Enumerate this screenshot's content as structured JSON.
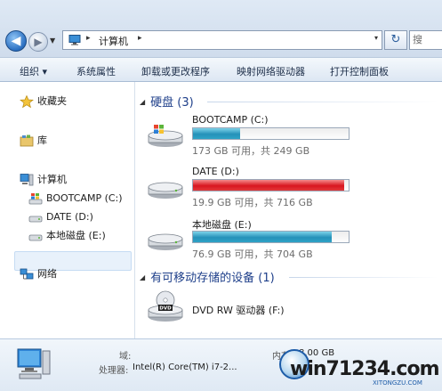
{
  "address": {
    "crumb": "计算机",
    "sep1": "▸",
    "sep2": "▸",
    "dropdown": "▾",
    "search_text": "搜"
  },
  "toolbar": {
    "organize": "组织 ▾",
    "system_properties": "系统属性",
    "uninstall": "卸载或更改程序",
    "map_drive": "映射网络驱动器",
    "control_panel": "打开控制面板"
  },
  "nav": {
    "favorites": "收藏夹",
    "libraries": "库",
    "computer": "计算机",
    "drives": [
      "BOOTCAMP (C:)",
      "DATE (D:)",
      "本地磁盘 (E:)"
    ],
    "network": "网络"
  },
  "groups": {
    "hard_disks": "硬盘 (3)",
    "removable": "有可移动存储的设备 (1)"
  },
  "drives": [
    {
      "name": "BOOTCAMP (C:)",
      "size_text": "173 GB 可用，共 249 GB",
      "used_fraction": 0.305,
      "color": "blue"
    },
    {
      "name": "DATE (D:)",
      "size_text": "19.9 GB 可用，共 716 GB",
      "used_fraction": 0.972,
      "color": "red"
    },
    {
      "name": "本地磁盘 (E:)",
      "size_text": "76.9 GB 可用，共 704 GB",
      "used_fraction": 0.891,
      "color": "blue"
    }
  ],
  "dvd": {
    "name": "DVD RW 驱动器 (F:)",
    "icon_label": "DVD"
  },
  "details": {
    "domain_label": "域:",
    "memory_label": "内存:",
    "memory_value": "8.00 GB",
    "cpu_label": "处理器:",
    "cpu_value": "Intel(R) Core(TM) i7-2..."
  },
  "watermark": {
    "text": "win71234.com",
    "sub": "XITONGZU.COM"
  },
  "colors": {
    "bar_blue": "#2591b9",
    "bar_red": "#d8161f",
    "group_header": "#1e3f8a"
  }
}
